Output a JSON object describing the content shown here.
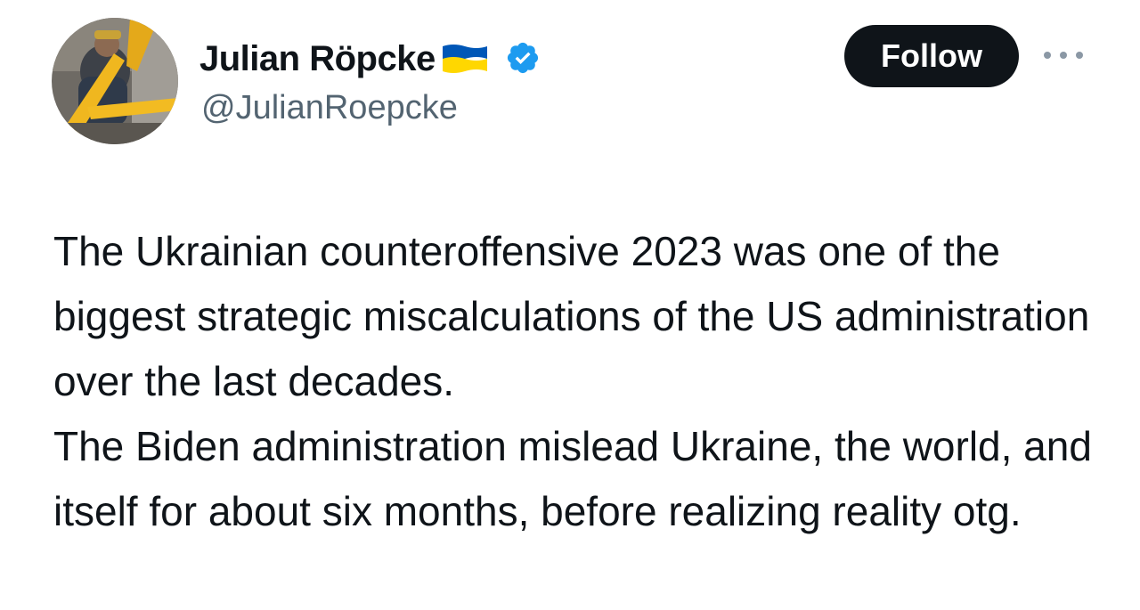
{
  "author": {
    "display_name": "Julian Röpcke",
    "handle": "@JulianRoepcke",
    "flag_icon": "ukraine-flag-icon",
    "verified_icon": "verified-badge-icon",
    "verified_color": "#1d9bf0"
  },
  "actions": {
    "follow_label": "Follow",
    "more_icon": "more-options-icon"
  },
  "tweet": {
    "paragraph_1": "The Ukrainian counteroffensive 2023 was one of the biggest strategic miscalculations of the US administration over the last decades.",
    "paragraph_2": "The Biden administration mislead Ukraine, the world, and itself for about six months, before realizing reality otg."
  },
  "colors": {
    "text": "#0f1419",
    "secondary_text": "#536471",
    "follow_button_bg": "#0f1419",
    "flag_blue": "#0057b7",
    "flag_yellow": "#ffd700"
  }
}
